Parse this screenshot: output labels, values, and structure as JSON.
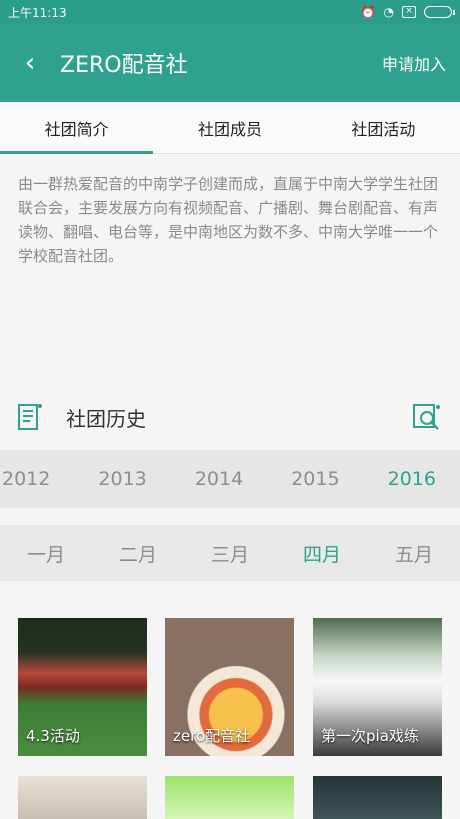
{
  "status": {
    "time": "上午11:13"
  },
  "appbar": {
    "title": "ZERO配音社",
    "action": "申请加入"
  },
  "tabs": [
    {
      "label": "社团简介"
    },
    {
      "label": "社团成员"
    },
    {
      "label": "社团活动"
    }
  ],
  "intro": "由一群热爱配音的中南学子创建而成，直属于中南大学学生社团联合会，主要发展方向有视频配音、广播剧、舞台剧配音、有声读物、翻唱、电台等，是中南地区为数不多、中南大学唯一一个学校配音社团。",
  "history": {
    "title": "社团历史"
  },
  "years": [
    "2012",
    "2013",
    "2014",
    "2015",
    "2016"
  ],
  "months": [
    "一月",
    "二月",
    "三月",
    "四月",
    "五月"
  ],
  "gallery": [
    {
      "label": "4.3活动"
    },
    {
      "label": "zero配音社"
    },
    {
      "label": "第一次pia戏练"
    },
    {
      "label": ""
    },
    {
      "label": ""
    },
    {
      "label": ""
    }
  ],
  "colors": {
    "primary": "#2fa28f",
    "status_bar": "#2b9e8b",
    "muted_text": "#8a8a8a"
  }
}
